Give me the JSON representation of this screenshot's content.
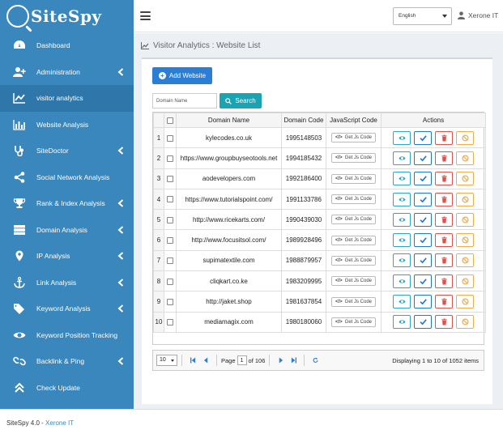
{
  "app": {
    "logo_text": "SiteSpy"
  },
  "topbar": {
    "language": "English",
    "user_name": "Xerone IT"
  },
  "sidebar": {
    "items": [
      {
        "label": "Dashboard",
        "icon": "dashboard-icon",
        "has_arrow": false
      },
      {
        "label": "Administration",
        "icon": "user-plus-icon",
        "has_arrow": true
      },
      {
        "label": "visitor analytics",
        "icon": "line-chart-icon",
        "has_arrow": false,
        "active": true
      },
      {
        "label": "Website Analysis",
        "icon": "bar-chart-icon",
        "has_arrow": false
      },
      {
        "label": "SiteDoctor",
        "icon": "stethoscope-icon",
        "has_arrow": true
      },
      {
        "label": "Social Network Analysis",
        "icon": "share-icon",
        "has_arrow": false
      },
      {
        "label": "Rank & Index Analysis",
        "icon": "trophy-icon",
        "has_arrow": true
      },
      {
        "label": "Domain Analysis",
        "icon": "server-icon",
        "has_arrow": true
      },
      {
        "label": "IP Analysis",
        "icon": "map-marker-icon",
        "has_arrow": true
      },
      {
        "label": "Link Analysis",
        "icon": "anchor-icon",
        "has_arrow": true
      },
      {
        "label": "Keyword Analysis",
        "icon": "tags-icon",
        "has_arrow": true
      },
      {
        "label": "Keyword Position Tracking",
        "icon": "eye-icon",
        "has_arrow": false
      },
      {
        "label": "Backlink & Ping",
        "icon": "link-icon",
        "has_arrow": true
      },
      {
        "label": "Check Update",
        "icon": "double-chevron-up-icon",
        "has_arrow": false
      }
    ]
  },
  "page": {
    "title": "Visitor Analytics : Website List",
    "add_button": "Add Website",
    "search_placeholder": "Domain Name",
    "search_button": "Search"
  },
  "table": {
    "columns": [
      "Domain Name",
      "Domain Code",
      "JavaScript Code",
      "Actions"
    ],
    "js_button_label": "Get Js Code",
    "rows": [
      {
        "num": "1",
        "domain": "kylecodes.co.uk",
        "code": "1995148503"
      },
      {
        "num": "2",
        "domain": "https://www.groupbuyseotools.net",
        "code": "1994185432"
      },
      {
        "num": "3",
        "domain": "aodevelopers.com",
        "code": "1992186400"
      },
      {
        "num": "4",
        "domain": "https://www.tutorialspoint.com/",
        "code": "1991133786"
      },
      {
        "num": "5",
        "domain": "http://www.ricekarts.com/",
        "code": "1990439030"
      },
      {
        "num": "6",
        "domain": "http://www.focusitsol.com/",
        "code": "1989928496"
      },
      {
        "num": "7",
        "domain": "supimatextile.com",
        "code": "1988879957"
      },
      {
        "num": "8",
        "domain": "cliqkart.co.ke",
        "code": "1983209995"
      },
      {
        "num": "9",
        "domain": "http://jaket.shop",
        "code": "1981637854"
      },
      {
        "num": "10",
        "domain": "mediamagix.com",
        "code": "1980180060"
      }
    ]
  },
  "pager": {
    "page_size": "10",
    "page_label": "Page",
    "page_value": "1",
    "of_label": "of 106",
    "info": "Displaying 1 to 10 of 1052 items"
  },
  "footer": {
    "version": "SiteSpy 4.0 - ",
    "company": "Xerone IT"
  },
  "colors": {
    "sidebar": "#3a87bd",
    "primary": "#2a7fd4",
    "search": "#1aa3b0",
    "danger": "#d9534f",
    "warning": "#f0ad4e",
    "info": "#2fa4c4"
  }
}
